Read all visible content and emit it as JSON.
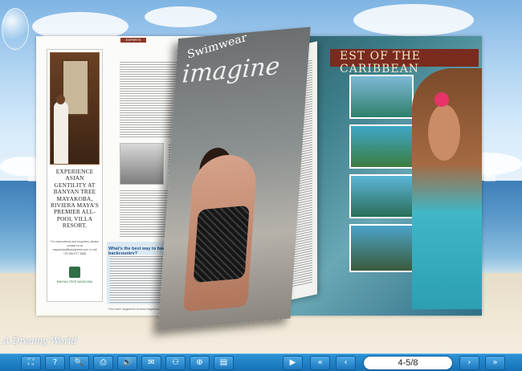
{
  "brand": "A Dreamy World",
  "nav": {
    "left_arrow": "◀",
    "right_arrow": "▶"
  },
  "left_page": {
    "section_tag": "EXPERTS",
    "ad_headline": "EXPERIENCE ASIAN GENTILITY AT BANYAN TREE MAYAKOBA, RIVIERA MAYA'S PREMIER ALL-POOL VILLA RESORT.",
    "ad_small_text": "For reservations and enquiries, please contact us at mayakoba@banyantree.com or call +52 984 877 3688",
    "ad_logo_text": "BANYAN TREE MAYAKOBA",
    "blue_heading": "What's the best way to have an adventure in Maui's backcountry?",
    "footer": "Find more magazines at www.magazinesdownload.com"
  },
  "flip_page": {
    "title": "imagine",
    "subtitle": "Swimwear"
  },
  "right_page": {
    "banner": "EST OF THE CARIBBEAN"
  },
  "toolbar": {
    "buttons": [
      {
        "id": "fit",
        "glyph": "⛶"
      },
      {
        "id": "help",
        "glyph": "?"
      },
      {
        "id": "zoom",
        "glyph": "🔍"
      },
      {
        "id": "print",
        "glyph": "⎙"
      },
      {
        "id": "sound",
        "glyph": "🔊"
      },
      {
        "id": "email",
        "glyph": "✉"
      },
      {
        "id": "share",
        "glyph": "⚇"
      },
      {
        "id": "search",
        "glyph": "⊕"
      },
      {
        "id": "download",
        "glyph": "▤"
      }
    ],
    "nav_buttons": {
      "play": "▶",
      "first": "«",
      "prev": "‹",
      "next": "›",
      "last": "»"
    },
    "page_indicator": "4-5/8"
  }
}
